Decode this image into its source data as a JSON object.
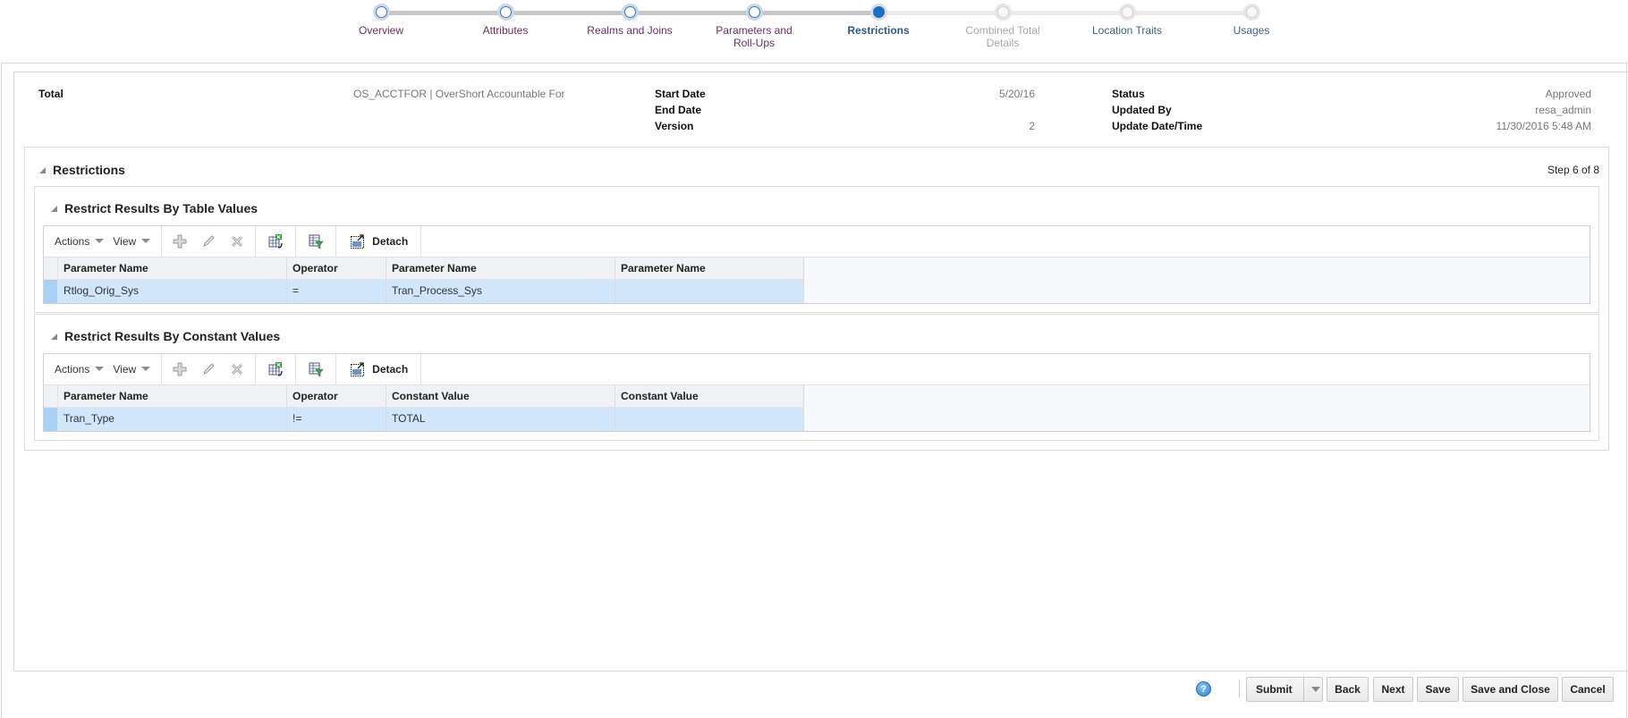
{
  "train": {
    "stops": [
      {
        "label": "Overview",
        "state": "visited"
      },
      {
        "label": "Attributes",
        "state": "visited"
      },
      {
        "label": "Realms and Joins",
        "state": "visited"
      },
      {
        "label": "Parameters and Roll-Ups",
        "state": "visited"
      },
      {
        "label": "Restrictions",
        "state": "current"
      },
      {
        "label": "Combined Total Details",
        "state": "disabled"
      },
      {
        "label": "Location Traits",
        "state": "future"
      },
      {
        "label": "Usages",
        "state": "future"
      }
    ]
  },
  "header": {
    "type_label": "Total",
    "total_id": "OS_ACCTFOR | OverShort Accountable For",
    "start_date_label": "Start Date",
    "start_date": "5/20/16",
    "end_date_label": "End Date",
    "end_date": "",
    "version_label": "Version",
    "version": "2",
    "status_label": "Status",
    "status": "Approved",
    "updated_by_label": "Updated By",
    "updated_by": "resa_admin",
    "update_datetime_label": "Update Date/Time",
    "update_datetime": "11/30/2016 5:48 AM"
  },
  "restrictions": {
    "title": "Restrictions",
    "step_text": "Step 6 of 8",
    "table_values": {
      "title": "Restrict Results By Table Values",
      "toolbar": {
        "actions": "Actions",
        "view": "View",
        "detach": "Detach"
      },
      "columns": [
        "Parameter Name",
        "Operator",
        "Parameter Name",
        "Parameter Name"
      ],
      "rows": [
        [
          "Rtlog_Orig_Sys",
          "=",
          "Tran_Process_Sys",
          ""
        ]
      ]
    },
    "constant_values": {
      "title": "Restrict Results By Constant Values",
      "toolbar": {
        "actions": "Actions",
        "view": "View",
        "detach": "Detach"
      },
      "columns": [
        "Parameter Name",
        "Operator",
        "Constant Value",
        "Constant Value"
      ],
      "rows": [
        [
          "Tran_Type",
          "!=",
          "TOTAL",
          ""
        ]
      ]
    }
  },
  "footer": {
    "help_glyph": "?",
    "buttons": {
      "submit": "Submit",
      "back": "Back",
      "next": "Next",
      "save": "Save",
      "save_close": "Save and Close",
      "cancel": "Cancel"
    }
  },
  "colors": {
    "visited_step_label": "#6a2c6a",
    "current_step": "#1a6fc6",
    "selected_row": "#cfe6fb"
  }
}
